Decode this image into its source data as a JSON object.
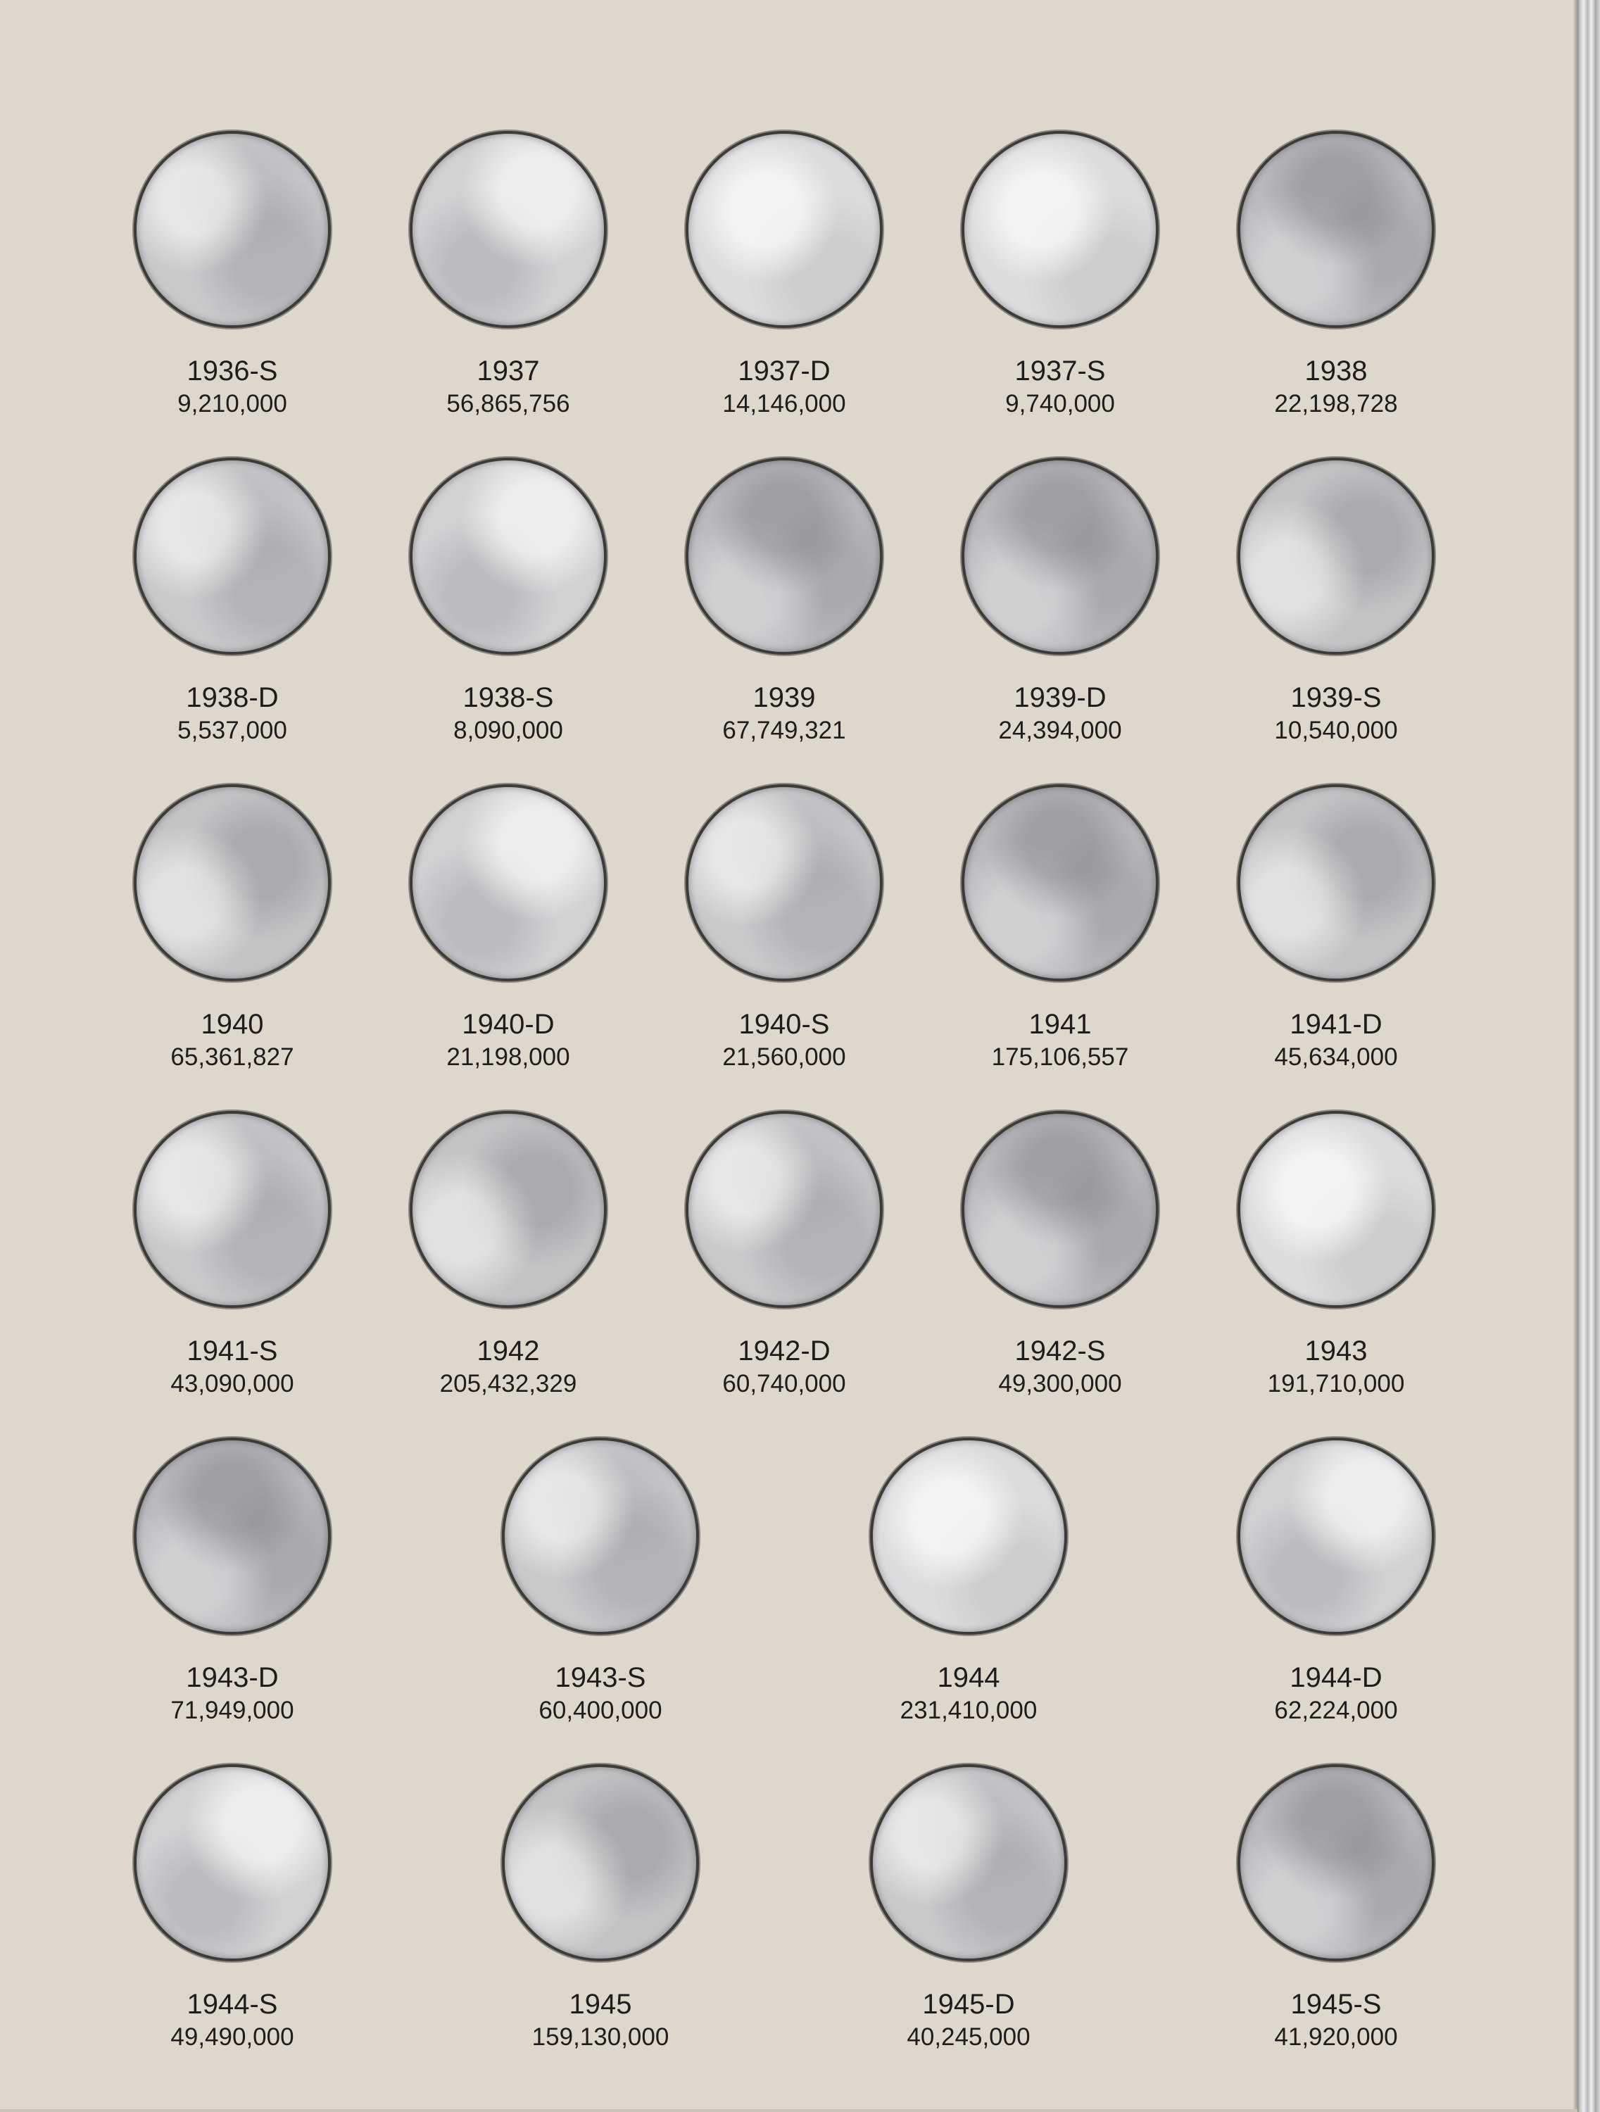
{
  "coins": [
    {
      "date": "1936-S",
      "mintage": "9,210,000"
    },
    {
      "date": "1937",
      "mintage": "56,865,756"
    },
    {
      "date": "1937-D",
      "mintage": "14,146,000"
    },
    {
      "date": "1937-S",
      "mintage": "9,740,000"
    },
    {
      "date": "1938",
      "mintage": "22,198,728"
    },
    {
      "date": "1938-D",
      "mintage": "5,537,000"
    },
    {
      "date": "1938-S",
      "mintage": "8,090,000"
    },
    {
      "date": "1939",
      "mintage": "67,749,321"
    },
    {
      "date": "1939-D",
      "mintage": "24,394,000"
    },
    {
      "date": "1939-S",
      "mintage": "10,540,000"
    },
    {
      "date": "1940",
      "mintage": "65,361,827"
    },
    {
      "date": "1940-D",
      "mintage": "21,198,000"
    },
    {
      "date": "1940-S",
      "mintage": "21,560,000"
    },
    {
      "date": "1941",
      "mintage": "175,106,557"
    },
    {
      "date": "1941-D",
      "mintage": "45,634,000"
    },
    {
      "date": "1941-S",
      "mintage": "43,090,000"
    },
    {
      "date": "1942",
      "mintage": "205,432,329"
    },
    {
      "date": "1942-D",
      "mintage": "60,740,000"
    },
    {
      "date": "1942-S",
      "mintage": "49,300,000"
    },
    {
      "date": "1943",
      "mintage": "191,710,000"
    },
    {
      "date": "1943-D",
      "mintage": "71,949,000"
    },
    {
      "date": "1943-S",
      "mintage": "60,400,000"
    },
    {
      "date": "1944",
      "mintage": "231,410,000"
    },
    {
      "date": "1944-D",
      "mintage": "62,224,000"
    },
    {
      "date": "1944-S",
      "mintage": "49,490,000"
    },
    {
      "date": "1945",
      "mintage": "159,130,000"
    },
    {
      "date": "1945-D",
      "mintage": "40,245,000"
    },
    {
      "date": "1945-S",
      "mintage": "41,920,000"
    }
  ]
}
